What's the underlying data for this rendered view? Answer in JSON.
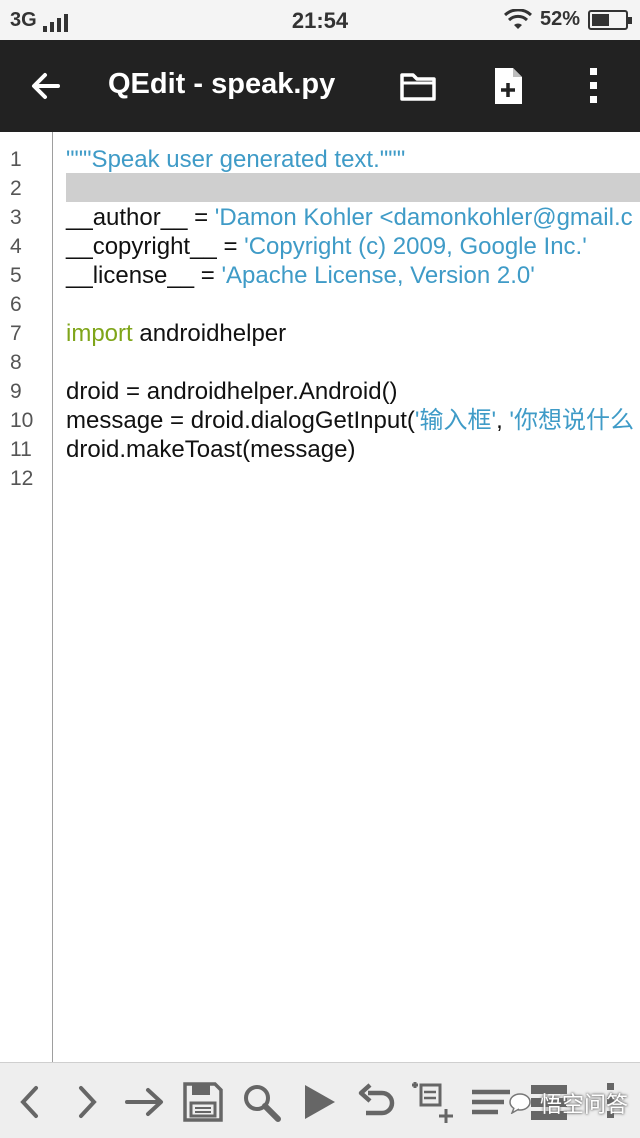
{
  "status_bar": {
    "network": "3G",
    "time": "21:54",
    "battery_percent": "52%",
    "battery_level": 0.52
  },
  "app_bar": {
    "title": "QEdit - speak.py",
    "icons": [
      "back-arrow-icon",
      "folder-icon",
      "new-file-icon",
      "overflow-menu-icon"
    ]
  },
  "editor": {
    "line_numbers": [
      "1",
      "2",
      "3",
      "4",
      "5",
      "6",
      "7",
      "8",
      "9",
      "10",
      "11",
      "12"
    ],
    "highlighted_line": 2,
    "lines": {
      "l1": {
        "s1": "\"\"\"Speak user generated text.\"\"\""
      },
      "l3": {
        "t1": "__author__ = ",
        "s1": "'Damon Kohler <damonkohler@gmail.c"
      },
      "l4": {
        "t1": "__copyright__ = ",
        "s1": "'Copyright (c) 2009, Google Inc.'"
      },
      "l5": {
        "t1": "__license__ = ",
        "s1": "'Apache License, Version 2.0'"
      },
      "l7": {
        "k1": "import",
        "t1": " androidhelper"
      },
      "l9": {
        "t1": "droid = androidhelper.Android()"
      },
      "l10": {
        "t1": "message = droid.dialogGetInput(",
        "s1": "'输入框'",
        "t2": ", ",
        "s2": "'你想说什么"
      },
      "l11": {
        "t1": "droid.makeToast(message)"
      }
    },
    "colors": {
      "string": "#3f9bc7",
      "keyword": "#7fa51a",
      "highlight": "#cfcfcf"
    }
  },
  "bottom_bar": {
    "icons": [
      "chevron-left-icon",
      "chevron-right-icon",
      "arrow-right-icon",
      "save-icon",
      "search-icon",
      "play-icon",
      "undo-icon",
      "add-snippet-icon",
      "format-icon",
      "list-icon",
      "overflow-icon"
    ],
    "watermark": "悟空问答"
  }
}
